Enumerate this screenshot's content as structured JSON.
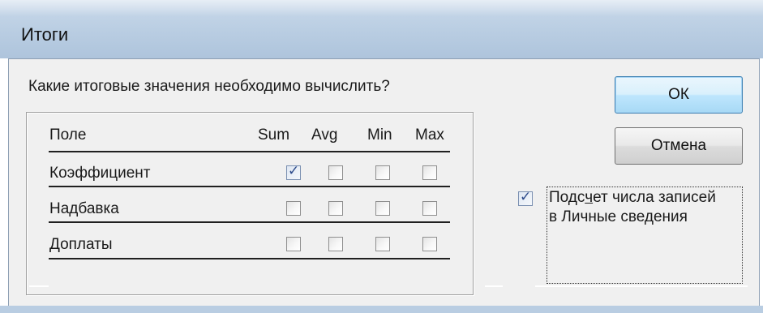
{
  "window": {
    "title": "Итоги"
  },
  "question": "Какие итоговые значения необходимо вычислить?",
  "table": {
    "headers": {
      "field": "Поле",
      "sum": "Sum",
      "avg": "Avg",
      "min": "Min",
      "max": "Max"
    },
    "rows": [
      {
        "label": "Коэффициент",
        "sum": true,
        "avg": false,
        "min": false,
        "max": false
      },
      {
        "label": "Надбавка",
        "sum": false,
        "avg": false,
        "min": false,
        "max": false
      },
      {
        "label": "Доплаты",
        "sum": false,
        "avg": false,
        "min": false,
        "max": false
      }
    ]
  },
  "buttons": {
    "ok": "ОК",
    "cancel": "Отмена"
  },
  "count_option": {
    "checked": true,
    "line1_pre": "Подс",
    "line1_u": "ч",
    "line1_post": "ет числа записей",
    "line2": "в Личные сведения"
  }
}
